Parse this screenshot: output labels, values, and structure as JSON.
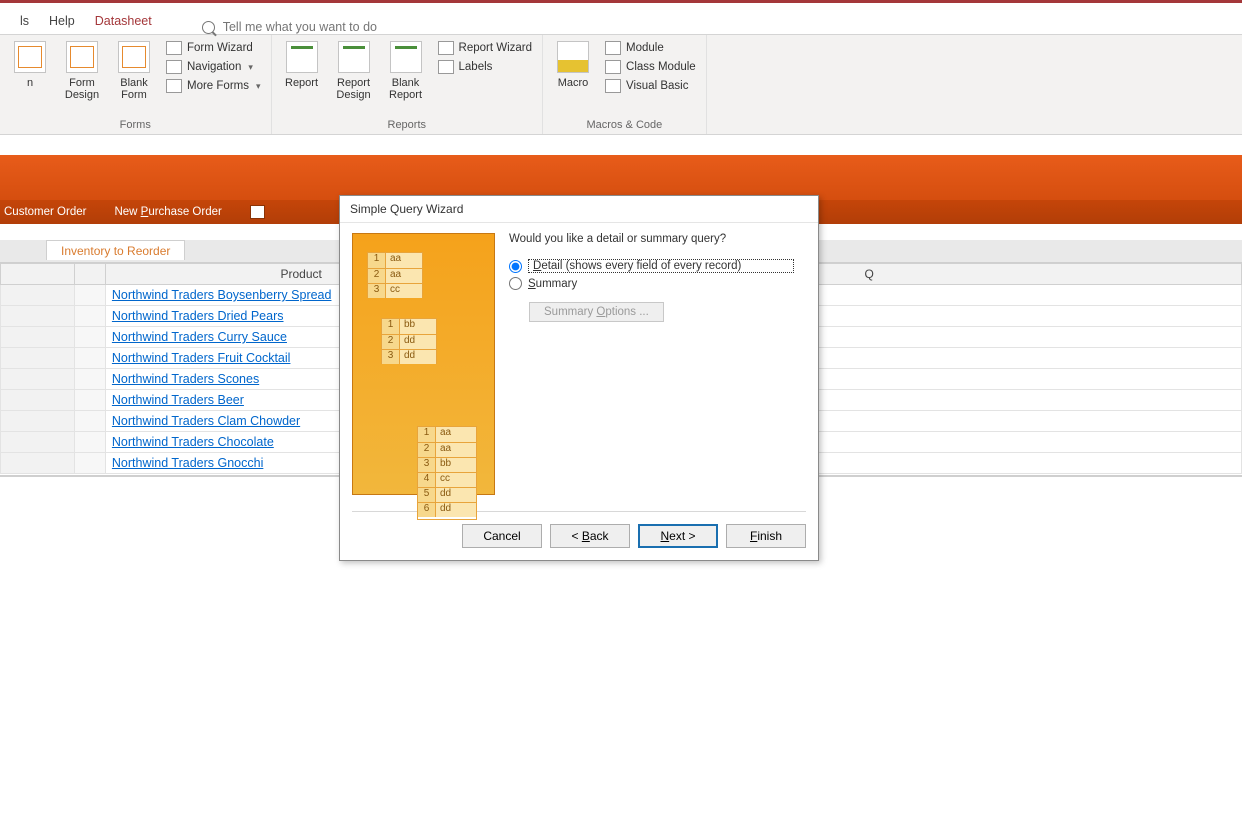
{
  "tabs": {
    "t0": "ls",
    "t1": "Help",
    "t2": "Datasheet"
  },
  "tellme": "Tell me what you want to do",
  "ribbon": {
    "forms": {
      "btn0": "n",
      "btn1": "Form Design",
      "btn2": "Blank Form",
      "s0": "Form Wizard",
      "s1": "Navigation",
      "s2": "More Forms",
      "label": "Forms"
    },
    "reports": {
      "btn0": "Report",
      "btn1": "Report Design",
      "btn2": "Blank Report",
      "s0": "Report Wizard",
      "s1": "Labels",
      "label": "Reports"
    },
    "macros": {
      "btn0": "Macro",
      "s0": "Module",
      "s1": "Class Module",
      "s2": "Visual Basic",
      "label": "Macros & Code"
    }
  },
  "shortcuts": {
    "s0": "Customer Order",
    "s1": "New Purchase Order",
    "s1_u": "P"
  },
  "sheet": {
    "tab": "Inventory to Reorder",
    "colProduct": "Product",
    "colQ": "Q",
    "rows": [
      "Northwind Traders Boysenberry Spread",
      "Northwind Traders Dried Pears",
      "Northwind Traders Curry Sauce",
      "Northwind Traders Fruit Cocktail",
      "Northwind Traders Scones",
      "Northwind Traders Beer",
      "Northwind Traders Clam Chowder",
      "Northwind Traders Chocolate",
      "Northwind Traders Gnocchi"
    ]
  },
  "dialog": {
    "title": "Simple Query Wizard",
    "question": "Would you like a detail or summary query?",
    "opt_detail": "Detail (shows every field of every record)",
    "opt_summary": "Summary",
    "opt_summary_u": "S",
    "summary_opts": "Summary Options ...",
    "summary_opts_u": "O",
    "cancel": "Cancel",
    "back": "< Back",
    "back_u": "B",
    "next": "Next >",
    "next_u": "N",
    "finish": "Finish",
    "finish_u": "F",
    "wiz": {
      "r": [
        "1",
        "2",
        "3",
        "4",
        "5",
        "6"
      ],
      "v": [
        "aa",
        "aa",
        "cc",
        "bb",
        "dd",
        "dd",
        "aa",
        "aa",
        "bb",
        "cc",
        "dd",
        "dd"
      ]
    }
  }
}
